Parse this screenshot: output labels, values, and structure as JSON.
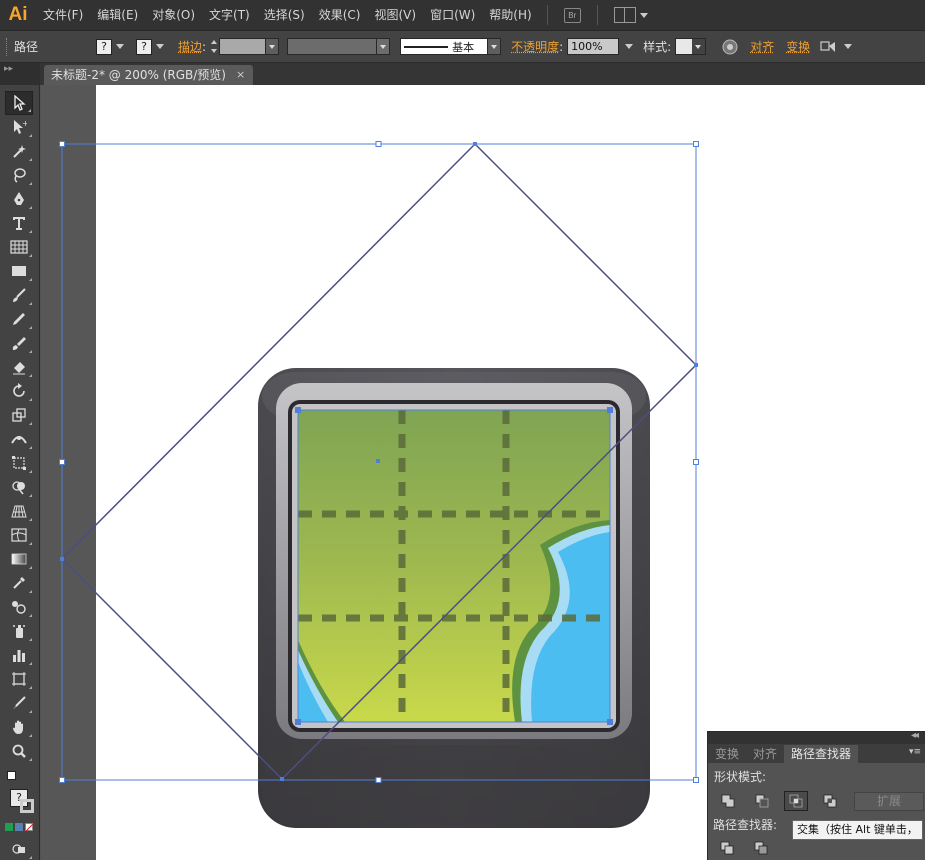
{
  "app": {
    "logo": "Ai",
    "menus": [
      "文件(F)",
      "编辑(E)",
      "对象(O)",
      "文字(T)",
      "选择(S)",
      "效果(C)",
      "视图(V)",
      "窗口(W)",
      "帮助(H)"
    ],
    "bridge_label": "Br"
  },
  "control_bar": {
    "object_type": "路径",
    "fill_swatch": "?",
    "stroke_swatch": "?",
    "stroke_label": "描边",
    "stroke_profile": "基本",
    "opacity_label": "不透明度",
    "opacity_value": "100%",
    "style_label": "样式",
    "align_label": "对齐",
    "transform_label": "变换"
  },
  "document_tab": {
    "title": "未标题-2* @ 200% (RGB/预览)",
    "close": "×"
  },
  "toolbox": {
    "tools": [
      "selection",
      "direct-selection",
      "magic-wand",
      "lasso",
      "pen",
      "type",
      "line-segment",
      "rectangle",
      "paintbrush",
      "pencil",
      "blob-brush",
      "eraser",
      "rotate",
      "scale",
      "width",
      "free-transform",
      "shape-builder",
      "perspective-grid",
      "mesh",
      "gradient",
      "eyedropper",
      "blend",
      "symbol-sprayer",
      "column-graph",
      "artboard",
      "slice",
      "hand",
      "zoom"
    ]
  },
  "pathfinder_panel": {
    "tabs": [
      "变换",
      "对齐",
      "路径查找器"
    ],
    "active_tab": "路径查找器",
    "shape_modes_label": "形状模式:",
    "expand_button": "扩展",
    "pathfinders_label": "路径查找器:",
    "tooltip": "交集（按住 Alt 键单击，"
  },
  "colors": {
    "accent_orange": "#f0a030",
    "selection_blue": "#4f7fd6",
    "map_green_top": "#7fa453",
    "map_green_bottom": "#c9d94b",
    "water_blue": "#4bbdf0",
    "frame_dark": "#4a494d"
  }
}
